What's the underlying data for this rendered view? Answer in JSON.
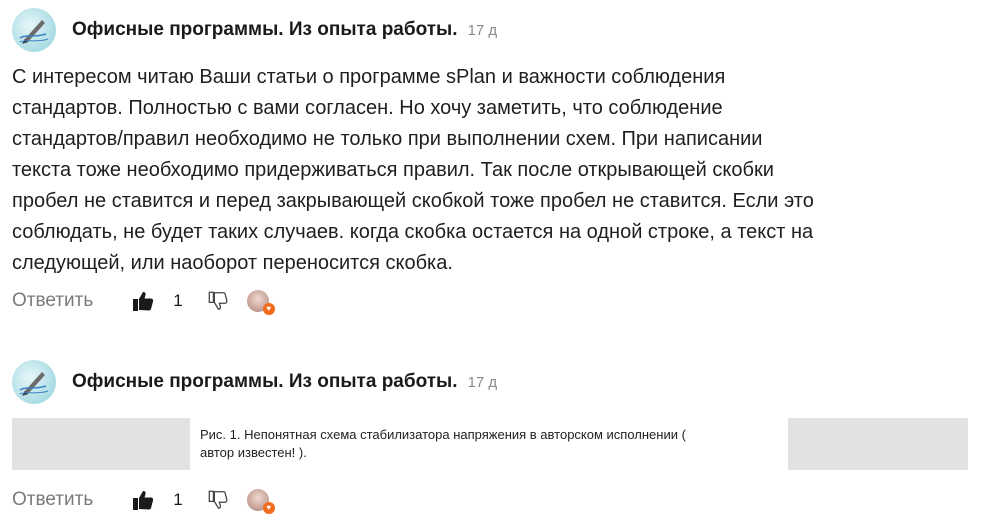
{
  "comments": [
    {
      "author": "Офисные программы. Из опыта работы.",
      "time": "17 д",
      "text": "С интересом читаю Ваши статьи о программе sPlan и важности соблюдения\nстандартов. Полностью с вами согласен. Но хочу заметить, что соблюдение\nстандартов/правил необходимо не только при выполнении схем. При написании\nтекста тоже необходимо придерживаться правил. Так после открывающей скобки\nпробел не ставится и перед закрывающей скобкой тоже пробел не ставится. Если это\nсоблюдать, не будет таких случаев. когда скобка остается на одной строке, а текст на\nследующей, или наоборот переносится скобка.",
      "reply_label": "Ответить",
      "likes": "1",
      "like_icon": "thumbs-up-filled-icon",
      "dislike_icon": "thumbs-down-outline-icon"
    },
    {
      "author": "Офисные программы. Из опыта работы.",
      "time": "17 д",
      "image_caption_line1": "Рис. 1. Непонятная схема стабилизатора напряжения в авторском исполнении (",
      "image_caption_line2": " автор известен! ).",
      "reply_label": "Ответить",
      "likes": "1",
      "like_icon": "thumbs-up-filled-icon",
      "dislike_icon": "thumbs-down-outline-icon"
    }
  ],
  "colors": {
    "text": "#1f1f1f",
    "muted": "#7a7a7a",
    "heart": "#f26a1b",
    "placeholder": "#e2e2e2"
  }
}
